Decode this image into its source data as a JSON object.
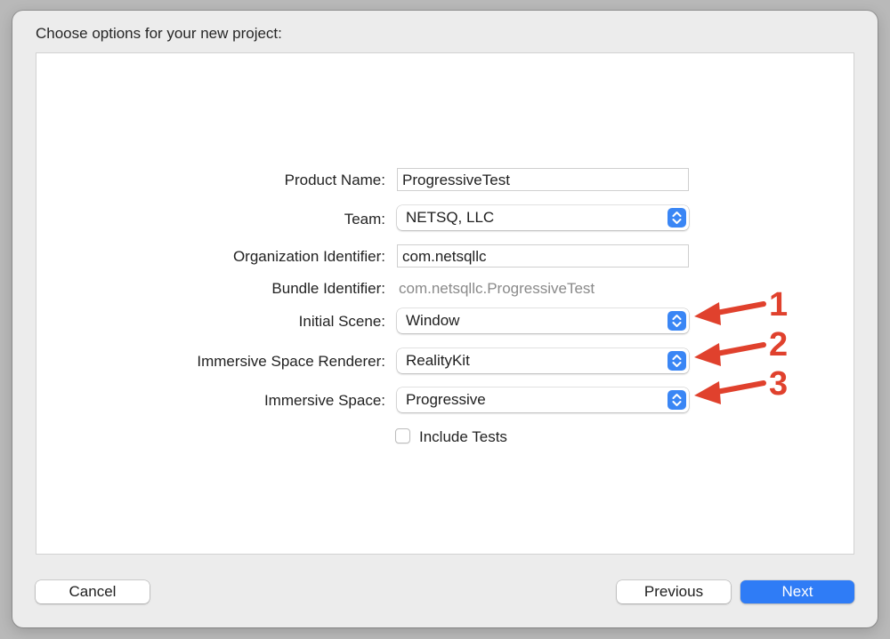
{
  "dialog": {
    "title": "Choose options for your new project:"
  },
  "form": {
    "product_name": {
      "label": "Product Name:",
      "value": "ProgressiveTest"
    },
    "team": {
      "label": "Team:",
      "value": "NETSQ, LLC"
    },
    "organization_identifier": {
      "label": "Organization Identifier:",
      "value": "com.netsqllc"
    },
    "bundle_identifier": {
      "label": "Bundle Identifier:",
      "value": "com.netsqllc.ProgressiveTest"
    },
    "initial_scene": {
      "label": "Initial Scene:",
      "value": "Window"
    },
    "immersive_space_renderer": {
      "label": "Immersive Space Renderer:",
      "value": "RealityKit"
    },
    "immersive_space": {
      "label": "Immersive Space:",
      "value": "Progressive"
    },
    "include_tests": {
      "label": "Include Tests",
      "checked": false
    }
  },
  "annotations": [
    {
      "number": "1"
    },
    {
      "number": "2"
    },
    {
      "number": "3"
    }
  ],
  "buttons": {
    "cancel": "Cancel",
    "previous": "Previous",
    "next": "Next"
  },
  "colors": {
    "accent": "#2f7cf6",
    "annotation": "#e0412d",
    "window_background": "#ececec"
  },
  "icons": {
    "popup_stepper": "chevron-up-down-icon",
    "annotation_arrow": "arrow-left-icon",
    "checkbox": "checkbox-unchecked-icon"
  }
}
